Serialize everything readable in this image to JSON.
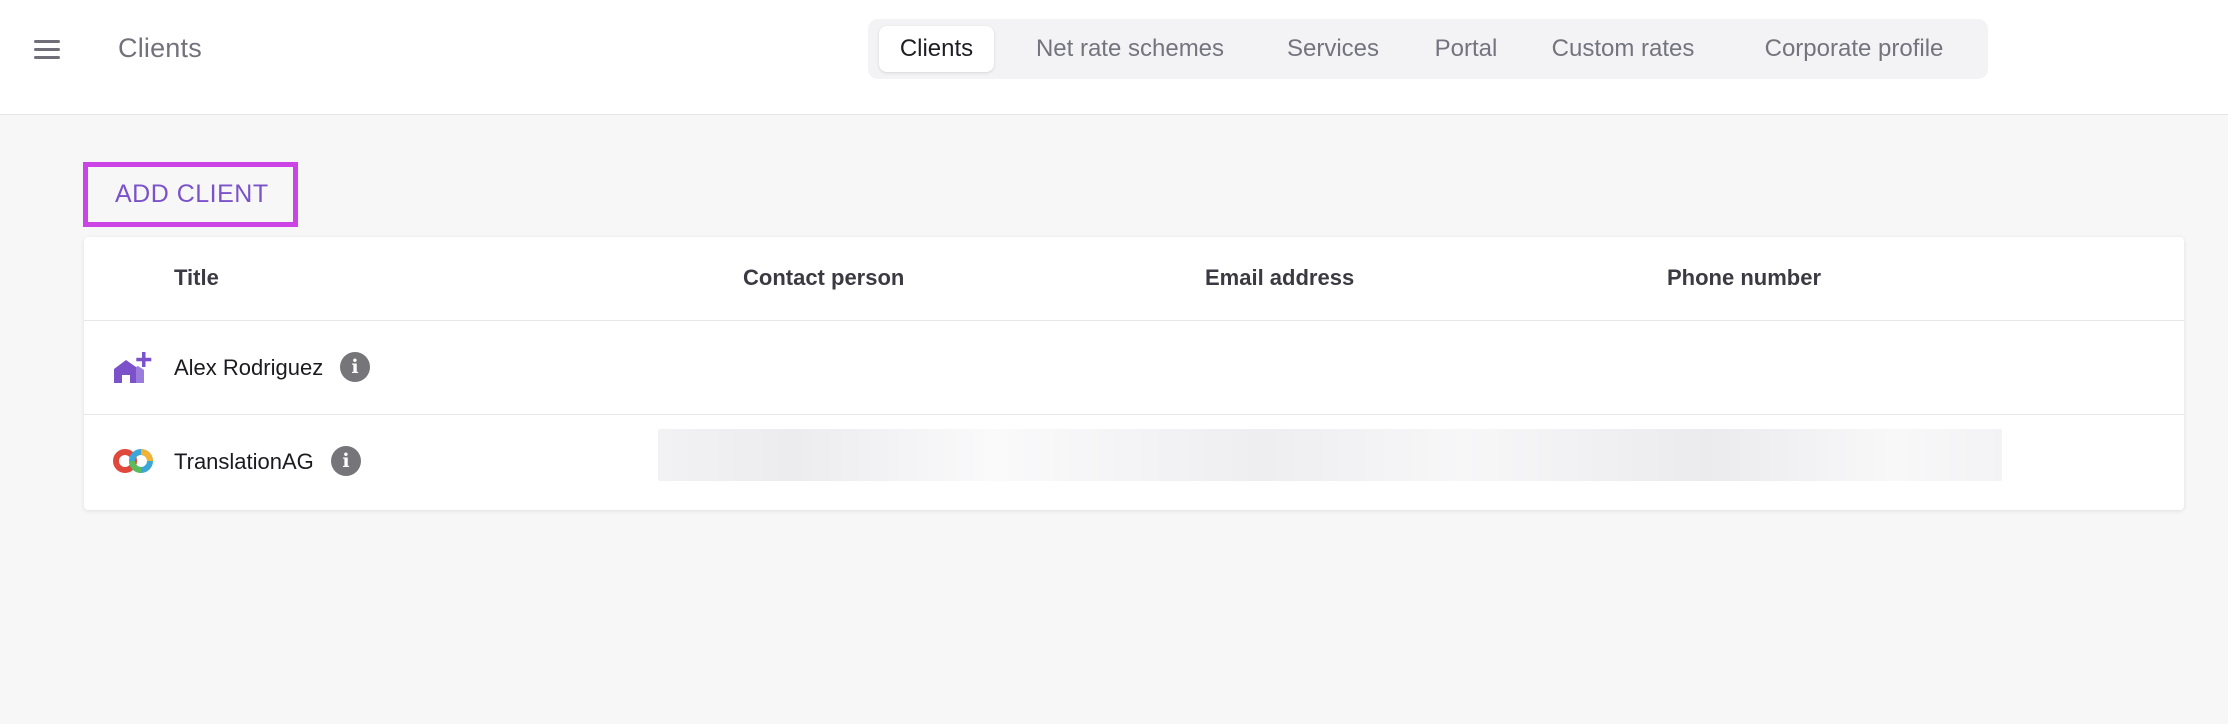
{
  "header": {
    "menu_icon": "hamburger-menu-icon",
    "title": "Clients",
    "tabs": [
      {
        "label": "Clients",
        "active": true
      },
      {
        "label": "Net rate schemes",
        "active": false
      },
      {
        "label": "Services",
        "active": false
      },
      {
        "label": "Portal",
        "active": false
      },
      {
        "label": "Custom rates",
        "active": false
      },
      {
        "label": "Corporate profile",
        "active": false
      }
    ]
  },
  "main": {
    "add_button_label": "ADD CLIENT",
    "table": {
      "columns": [
        "Title",
        "Contact person",
        "Email address",
        "Phone number"
      ],
      "rows": [
        {
          "icon": "house-plus-icon",
          "title": "Alex Rodriguez",
          "info_icon": "i",
          "contact": "",
          "email": "",
          "phone": ""
        },
        {
          "icon": "translationag-logo-icon",
          "title": "TranslationAG",
          "info_icon": "i",
          "contact": "",
          "email": "",
          "phone": "",
          "loading": true
        }
      ]
    }
  },
  "colors": {
    "accent": "#7b52c9",
    "highlight_border": "#cc44e6",
    "page_background": "#f7f7f7",
    "info_icon": "#75757a"
  }
}
